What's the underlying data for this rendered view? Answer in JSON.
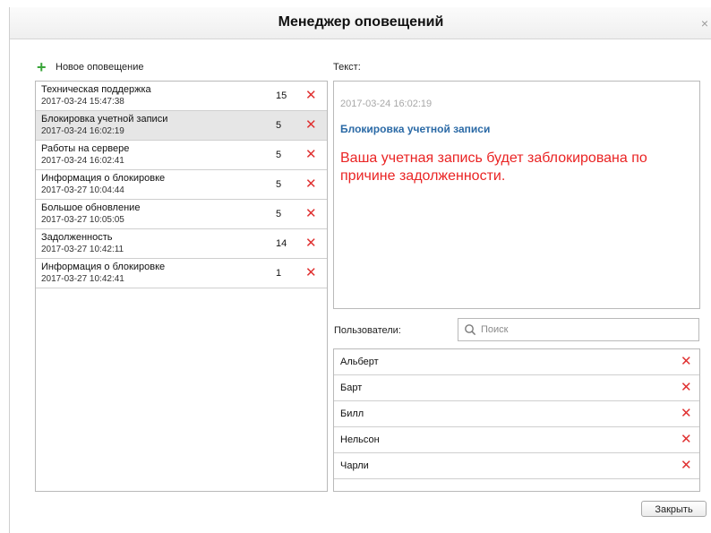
{
  "dialog": {
    "title": "Менеджер оповещений",
    "close_glyph": "×"
  },
  "toolbar": {
    "new_alert_label": "Новое оповещение",
    "new_alert_icon": "plus-icon"
  },
  "alerts": [
    {
      "name": "Техническая поддержка",
      "date": "2017-03-24 15:47:38",
      "count": "15",
      "selected": false
    },
    {
      "name": "Блокировка учетной записи",
      "date": "2017-03-24 16:02:19",
      "count": "5",
      "selected": true
    },
    {
      "name": "Работы на сервере",
      "date": "2017-03-24 16:02:41",
      "count": "5",
      "selected": false
    },
    {
      "name": "Информация о блокировке",
      "date": "2017-03-27 10:04:44",
      "count": "5",
      "selected": false
    },
    {
      "name": "Большое обновление",
      "date": "2017-03-27 10:05:05",
      "count": "5",
      "selected": false
    },
    {
      "name": "Задолженность",
      "date": "2017-03-27 10:42:11",
      "count": "14",
      "selected": false
    },
    {
      "name": "Информация о блокировке",
      "date": "2017-03-27 10:42:41",
      "count": "1",
      "selected": false
    }
  ],
  "text_panel": {
    "label": "Текст:",
    "date": "2017-03-24 16:02:19",
    "subject": "Блокировка учетной записи",
    "body": "Ваша учетная запись будет заблокирована по причине задолженности."
  },
  "users": {
    "label": "Пользователи:",
    "search_placeholder": "Поиск",
    "items": [
      "Альберт",
      "Барт",
      "Билл",
      "Нельсон",
      "Чарли"
    ]
  },
  "footer": {
    "close_label": "Закрыть"
  },
  "colors": {
    "delete": "#e03030",
    "accent_link": "#2b6aa6",
    "alert_text": "#ea2424",
    "add": "#3aa53a",
    "selected_row": "#e6e6e6"
  },
  "delete_glyph": "✕"
}
